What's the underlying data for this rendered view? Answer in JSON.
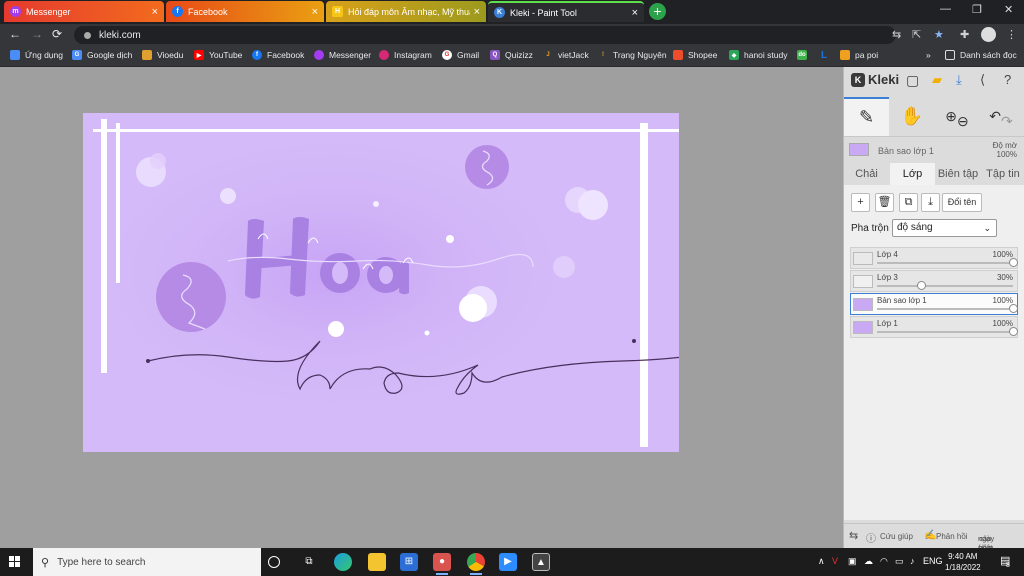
{
  "browser": {
    "tabs": [
      {
        "label": "Messenger",
        "icon": "messenger-icon",
        "color": "#a33cf0"
      },
      {
        "label": "Facebook",
        "icon": "facebook-icon",
        "color": "#1877f2"
      },
      {
        "label": "Hỏi đáp môn Âm nhạc, Mỹ thuật",
        "icon": "hoidap-icon",
        "color": "#f5c518"
      },
      {
        "label": "Kleki - Paint Tool",
        "icon": "kleki-icon",
        "color": "#3b80d6"
      }
    ],
    "close_glyph": "×",
    "new_tab_glyph": "+",
    "url": "kleki.com",
    "window_controls": {
      "minimize": "—",
      "restore": "❐",
      "close": "✕"
    },
    "nav": {
      "back": "←",
      "forward": "→",
      "reload": "⟳"
    }
  },
  "bookmarks": [
    {
      "label": "Ứng dụng",
      "color": "#4a8df7"
    },
    {
      "label": "Google dịch",
      "color": "#4a8df7"
    },
    {
      "label": "Vioedu",
      "color": "#e0a030"
    },
    {
      "label": "YouTube",
      "color": "#ff0000"
    },
    {
      "label": "Facebook",
      "color": "#1877f2"
    },
    {
      "label": "Messenger",
      "color": "#a33cf0"
    },
    {
      "label": "Instagram",
      "color": "#d62976"
    },
    {
      "label": "Gmail",
      "color": "#ffffff"
    },
    {
      "label": "Quizizz",
      "color": "#8854c0"
    },
    {
      "label": "vietJack",
      "color": "#f0a020"
    },
    {
      "label": "Trạng Nguyên",
      "color": "#e0b020"
    },
    {
      "label": "Shopee",
      "color": "#ee4d2d"
    },
    {
      "label": "hanoi study",
      "color": "#2aa55a"
    },
    {
      "label": "",
      "color": "#3fb24a"
    },
    {
      "label": "",
      "color": "#1e73d8"
    },
    {
      "label": "pa poi",
      "color": "#f0a020"
    }
  ],
  "bookmarks_more": "»",
  "reading_list": "Danh sách đọc",
  "kleki": {
    "logo": "Kleki",
    "preview_layer_name": "Bản sao lớp 1",
    "preview_opacity_label": "Độ mờ",
    "preview_opacity_value": "100%",
    "tabs": [
      "Chải",
      "Lớp",
      "Biên tập",
      "Tập tin"
    ],
    "active_tab": 1,
    "layer_buttons": [
      "+",
      "🗑",
      "⧉",
      "⤓"
    ],
    "rename_label": "Đổi tên",
    "blend_label": "Pha trộn",
    "blend_value": "độ sáng",
    "layers": [
      {
        "name": "Lớp 4",
        "opacity": "100%",
        "value": 1.0,
        "selected": false,
        "thumb": "#e9e9e9"
      },
      {
        "name": "Lớp 3",
        "opacity": "30%",
        "value": 0.3,
        "selected": false,
        "thumb": "#f0f0f0"
      },
      {
        "name": "Bản sao lớp 1",
        "opacity": "100%",
        "value": 1.0,
        "selected": true,
        "thumb": "#c9a8f4"
      },
      {
        "name": "Lớp 1",
        "opacity": "100%",
        "value": 1.0,
        "selected": false,
        "thumb": "#c9a8f4"
      }
    ],
    "footer": {
      "help": "Cứu giúp",
      "feedback": "Phản hồi",
      "update_line1": "cập nhật",
      "update_line2": "ngày hôm qua"
    }
  },
  "canvas": {
    "background": "#d4baf8",
    "handwriting": "h o a"
  },
  "taskbar": {
    "search_placeholder": "Type here to search",
    "lang": "ENG",
    "time": "9:40 AM",
    "date": "1/18/2022",
    "notif_count": "8"
  }
}
